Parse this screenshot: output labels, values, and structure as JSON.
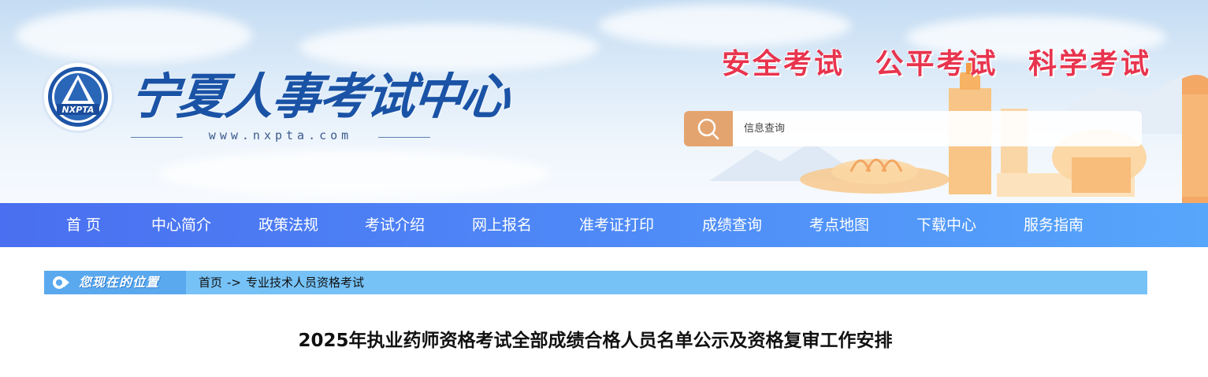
{
  "header": {
    "site_title": "宁夏人事考试中心",
    "site_url": "www.nxpta.com",
    "logo_text": "NXPTA",
    "slogans": [
      "安全考试",
      "公平考试",
      "科学考试"
    ],
    "search": {
      "placeholder": "信息查询",
      "icon": "search-icon"
    }
  },
  "nav": {
    "items": [
      "首 页",
      "中心简介",
      "政策法规",
      "考试介绍",
      "网上报名",
      "准考证打印",
      "成绩查询",
      "考点地图",
      "下载中心",
      "服务指南"
    ]
  },
  "breadcrumb": {
    "label": "您现在的位置",
    "home": "首页",
    "separator": "->",
    "current": "专业技术人员资格考试"
  },
  "article": {
    "title": "2025年执业药师资格考试全部成绩合格人员名单公示及资格复审工作安排"
  },
  "colors": {
    "nav_start": "#4a6ff0",
    "nav_end": "#56a6fb",
    "slogan": "#e8344e",
    "site_title": "#1a53a6",
    "search_button": "#e4a46f",
    "breadcrumb_bar": "#76c2f7"
  }
}
